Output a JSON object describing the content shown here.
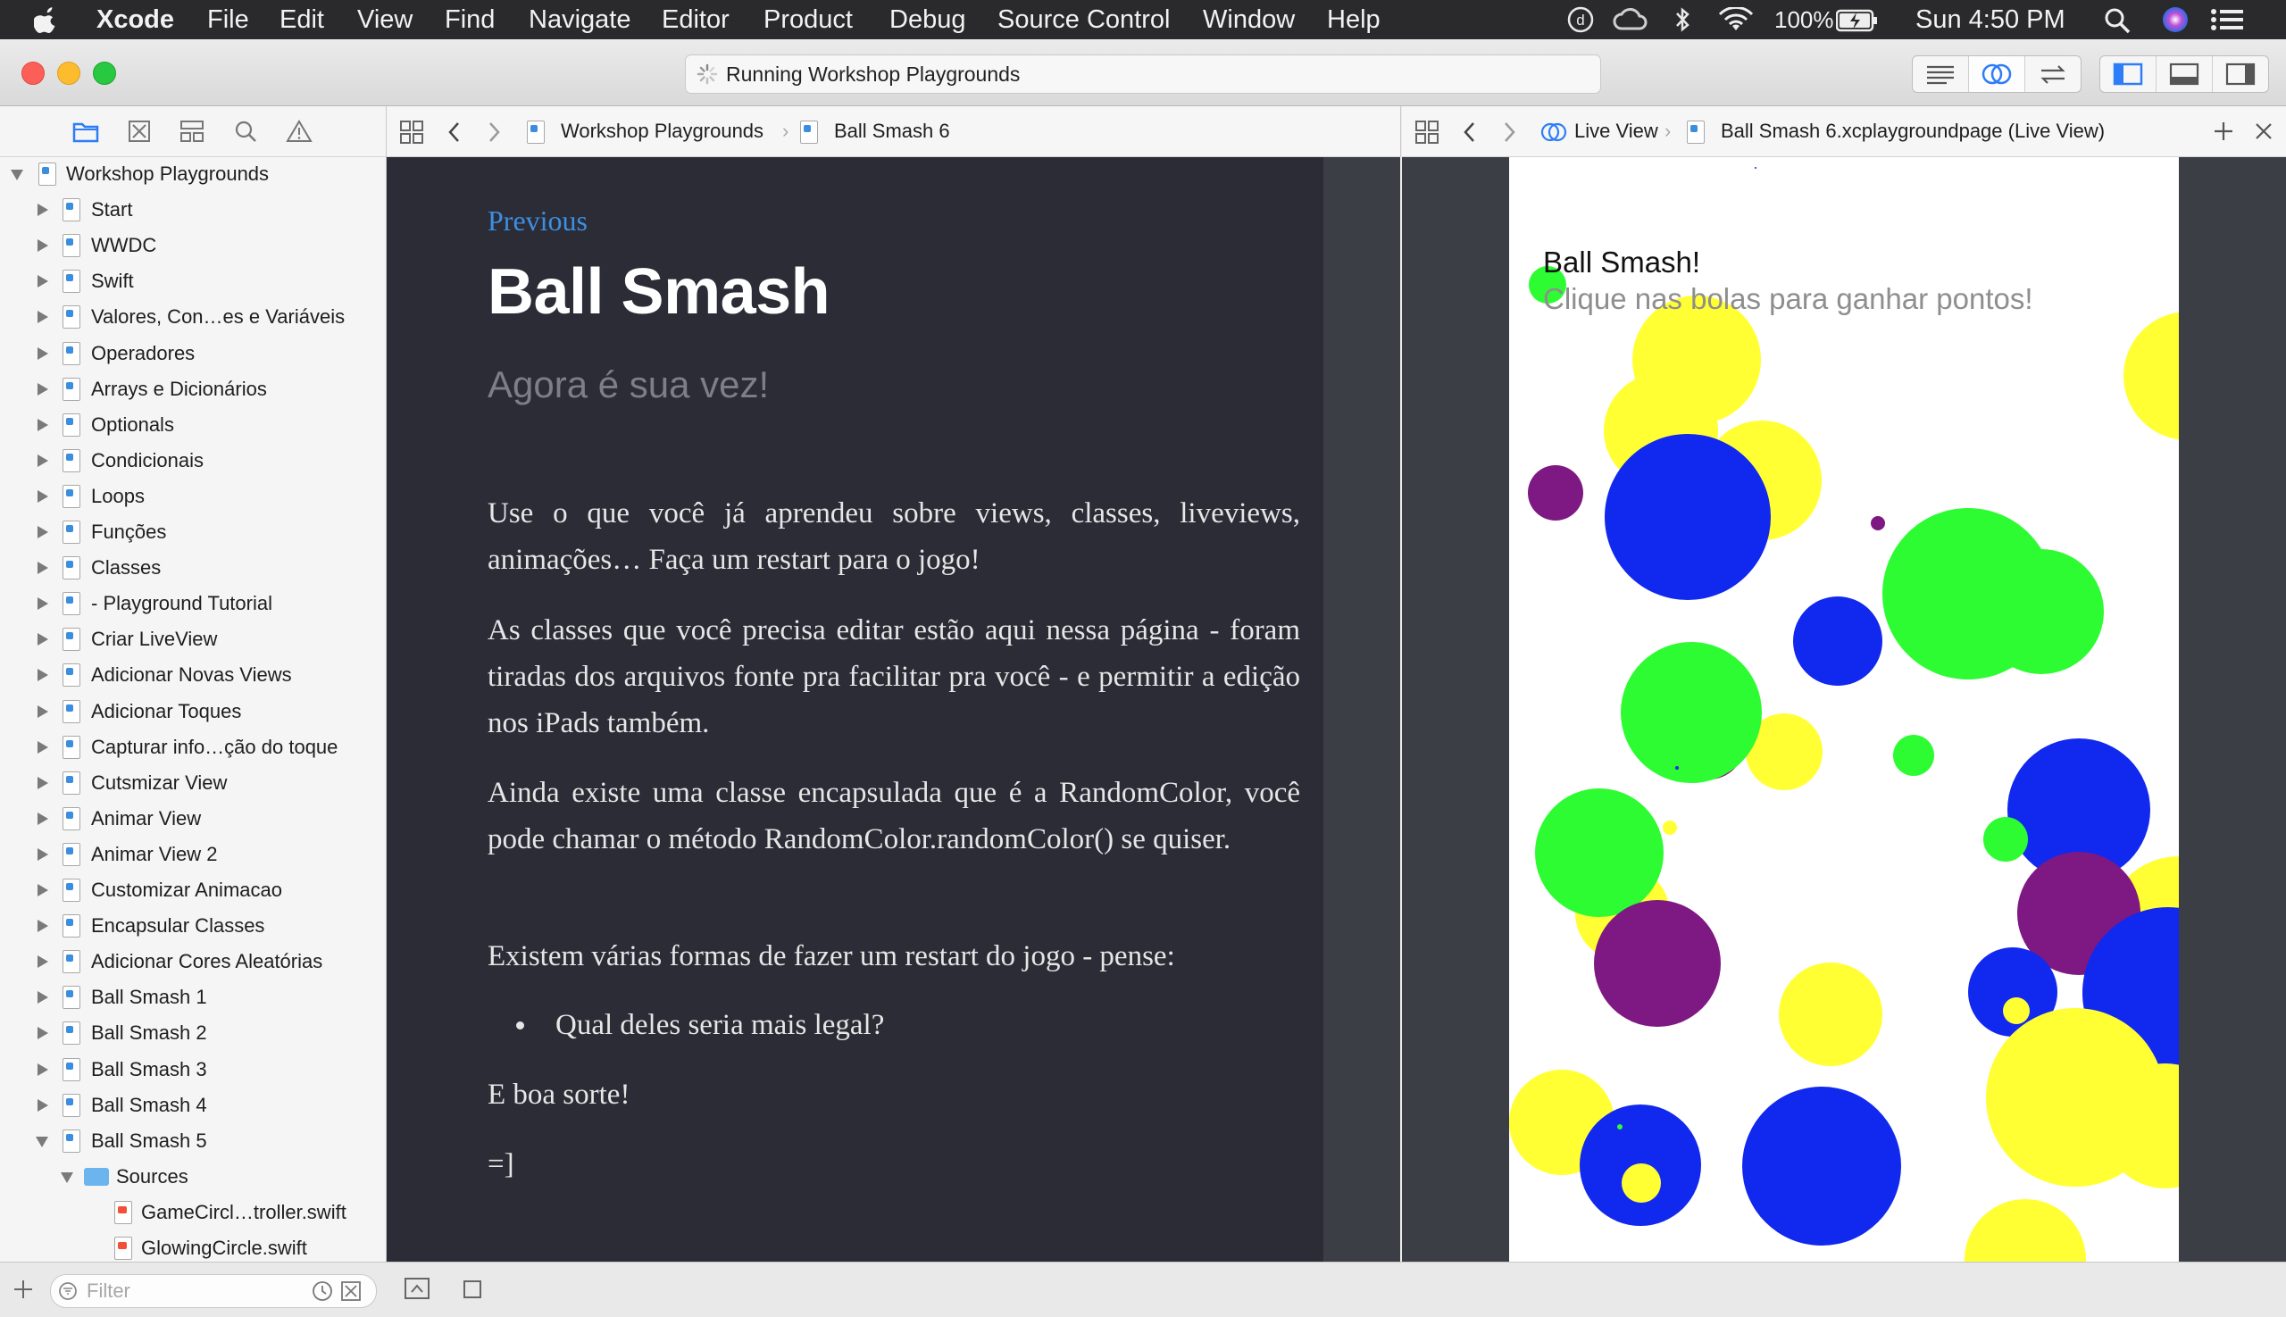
{
  "menubar": {
    "apple": "",
    "app": "Xcode",
    "items": [
      "File",
      "Edit",
      "View",
      "Find",
      "Navigate",
      "Editor",
      "Product",
      "Debug",
      "Source Control",
      "Window",
      "Help"
    ],
    "battery": "100%",
    "clock": "Sun 4:50 PM"
  },
  "toolbar": {
    "activity_text": "Running Workshop Playgrounds"
  },
  "navigator": {
    "root": "Workshop Playgrounds",
    "pages": [
      "Start",
      "WWDC",
      "Swift",
      "Valores, Con…es e Variáveis",
      "Operadores",
      "Arrays e Dicionários",
      "Optionals",
      "Condicionais",
      "Loops",
      "Funções",
      "Classes",
      "- Playground Tutorial",
      "Criar LiveView",
      "Adicionar Novas Views",
      "Adicionar Toques",
      "Capturar info…ção do toque",
      "Cutsmizar View",
      "Animar View",
      "Animar View 2",
      "Customizar Animacao",
      "Encapsular Classes",
      "Adicionar Cores Aleatórias",
      "Ball Smash 1",
      "Ball Smash 2",
      "Ball Smash 3",
      "Ball Smash 4",
      "Ball Smash 5"
    ],
    "folder": "Sources",
    "files": [
      "GameCircl…troller.swift",
      "GlowingCircle.swift"
    ],
    "filter_placeholder": "Filter"
  },
  "editor_jumpbar": {
    "crumbs": [
      "Workshop Playgrounds",
      "Ball Smash 6"
    ]
  },
  "assistant_jumpbar": {
    "crumbs": [
      "Live View",
      "Ball Smash 6.xcplaygroundpage (Live View)"
    ]
  },
  "markup": {
    "previous": "Previous",
    "title": "Ball Smash",
    "subtitle": "Agora é sua vez!",
    "p1": "Use o que você já aprendeu sobre views, classes, liveviews, animações… Faça um restart para o jogo!",
    "p2": "As classes que você precisa editar estão aqui nessa página - foram tiradas dos arquivos fonte pra facilitar pra você - e permitir a edição nos iPads também.",
    "p3": "Ainda existe uma classe encapsulada que é a RandomColor, você pode chamar o método RandomColor.randomColor() se quiser.",
    "p4": "Existem várias formas de fazer um restart do jogo - pense:",
    "bullet": "Qual deles seria mais legal?",
    "p5": "E boa sorte!",
    "p6": "=]"
  },
  "liveview": {
    "title": "Ball Smash!",
    "subtitle": "Clique nas bolas para ganhar pontos!",
    "colors": {
      "yellow": "#ffff33",
      "blue": "#1128ee",
      "green": "#2dfc32",
      "purple": "#7e1882"
    }
  }
}
